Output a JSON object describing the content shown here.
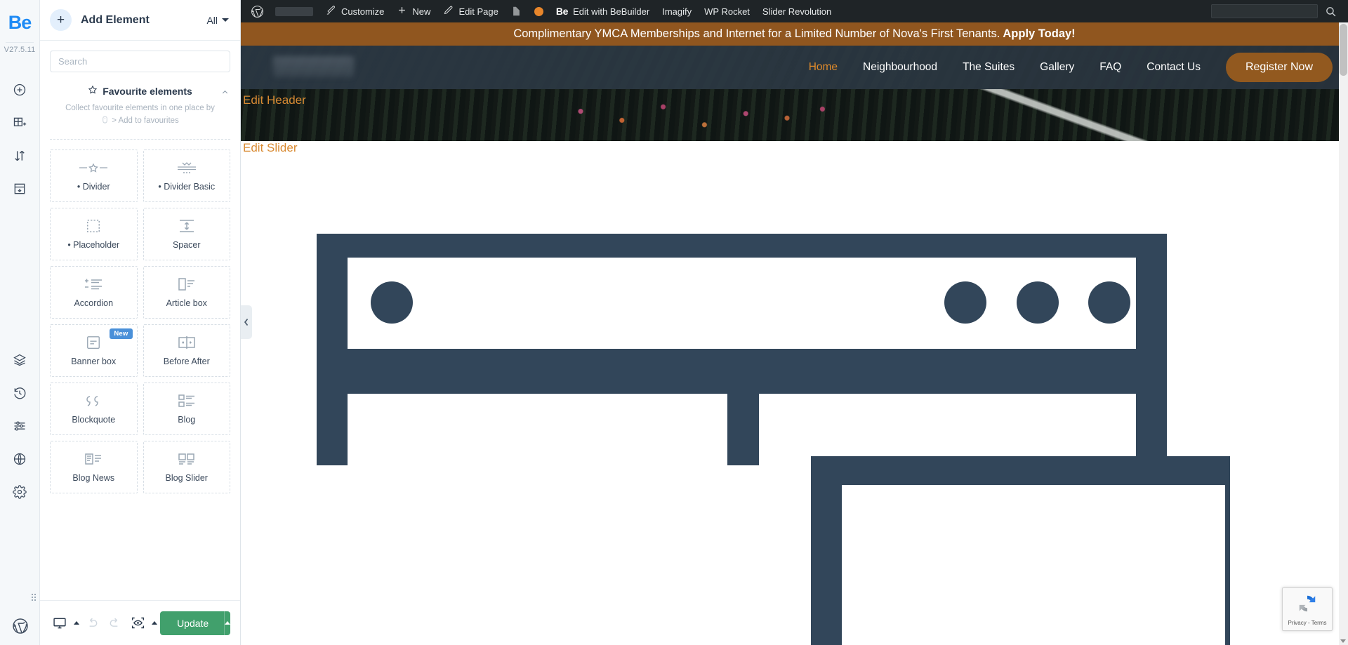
{
  "rail": {
    "logo": "Be",
    "version": "V27.5.11",
    "icons_top": [
      {
        "name": "add-element-icon",
        "label": "Add Element"
      },
      {
        "name": "add-section-icon",
        "label": "Add Section"
      },
      {
        "name": "reorder-icon",
        "label": "Reorder"
      },
      {
        "name": "add-row-icon",
        "label": "Add Row"
      }
    ],
    "icons_mid": [
      {
        "name": "layers-icon",
        "label": "Layers"
      },
      {
        "name": "history-icon",
        "label": "History"
      },
      {
        "name": "settings-sliders-icon",
        "label": "Settings"
      },
      {
        "name": "globe-icon",
        "label": "Global"
      },
      {
        "name": "gear-icon",
        "label": "Options"
      }
    ],
    "icon_bottom": {
      "name": "wordpress-icon",
      "label": "WordPress"
    }
  },
  "panel": {
    "add_element_label": "Add Element",
    "plus_icon": "+",
    "filter_label": "All",
    "search": {
      "placeholder": "Search",
      "value": ""
    },
    "favourites": {
      "title": "Favourite elements",
      "subtitle": "Collect favourite elements in one place by",
      "add_link": "> Add to favourites"
    },
    "elements": [
      {
        "label": "• Divider",
        "icon": "divider-star-icon",
        "new": false
      },
      {
        "label": "• Divider Basic",
        "icon": "divider-basic-icon",
        "new": false
      },
      {
        "label": "• Placeholder",
        "icon": "placeholder-icon",
        "new": false
      },
      {
        "label": "Spacer",
        "icon": "spacer-icon",
        "new": false
      },
      {
        "label": "Accordion",
        "icon": "accordion-icon",
        "new": false
      },
      {
        "label": "Article box",
        "icon": "article-box-icon",
        "new": false
      },
      {
        "label": "Banner box",
        "icon": "banner-box-icon",
        "new": true,
        "badge": "New"
      },
      {
        "label": "Before After",
        "icon": "before-after-icon",
        "new": false
      },
      {
        "label": "Blockquote",
        "icon": "blockquote-icon",
        "new": false
      },
      {
        "label": "Blog",
        "icon": "blog-icon",
        "new": false
      },
      {
        "label": "Blog News",
        "icon": "blog-news-icon",
        "new": false
      },
      {
        "label": "Blog Slider",
        "icon": "blog-slider-icon",
        "new": false
      }
    ],
    "footer": {
      "responsive_label": "Responsive",
      "undo_label": "Undo",
      "redo_label": "Redo",
      "preview_label": "Preview",
      "update_label": "Update"
    }
  },
  "adminbar": {
    "items": [
      {
        "label": "Customize",
        "icon": "brush-icon"
      },
      {
        "label": "New",
        "icon": "plus-icon"
      },
      {
        "label": "Edit Page",
        "icon": "pencil-icon"
      },
      {
        "label": "Edit with BeBuilder",
        "icon": "be-icon"
      },
      {
        "label": "Imagify",
        "icon": null
      },
      {
        "label": "WP Rocket",
        "icon": null
      },
      {
        "label": "Slider Revolution",
        "icon": null
      }
    ],
    "search": {
      "placeholder": "",
      "value": ""
    }
  },
  "site": {
    "promo_text": "Complimentary YMCA Memberships and Internet for a Limited Number of Nova's First Tenants.",
    "promo_cta": "Apply Today!",
    "nav": [
      {
        "label": "Home",
        "active": true
      },
      {
        "label": "Neighbourhood",
        "active": false
      },
      {
        "label": "The Suites",
        "active": false
      },
      {
        "label": "Gallery",
        "active": false
      },
      {
        "label": "FAQ",
        "active": false
      },
      {
        "label": "Contact Us",
        "active": false
      }
    ],
    "register_button": "Register Now",
    "edit_header_label": "Edit Header",
    "edit_slider_label": "Edit Slider"
  },
  "recaptcha": {
    "text": "Privacy - Terms"
  },
  "colors": {
    "brand_blue": "#1e8bf5",
    "promo_brown": "#90561f",
    "accent_orange": "#d98b33",
    "update_green": "#41a06c",
    "wireframe_slate": "#32465a",
    "admin_dark": "#1f2427",
    "badge_blue": "#4a90d9"
  }
}
